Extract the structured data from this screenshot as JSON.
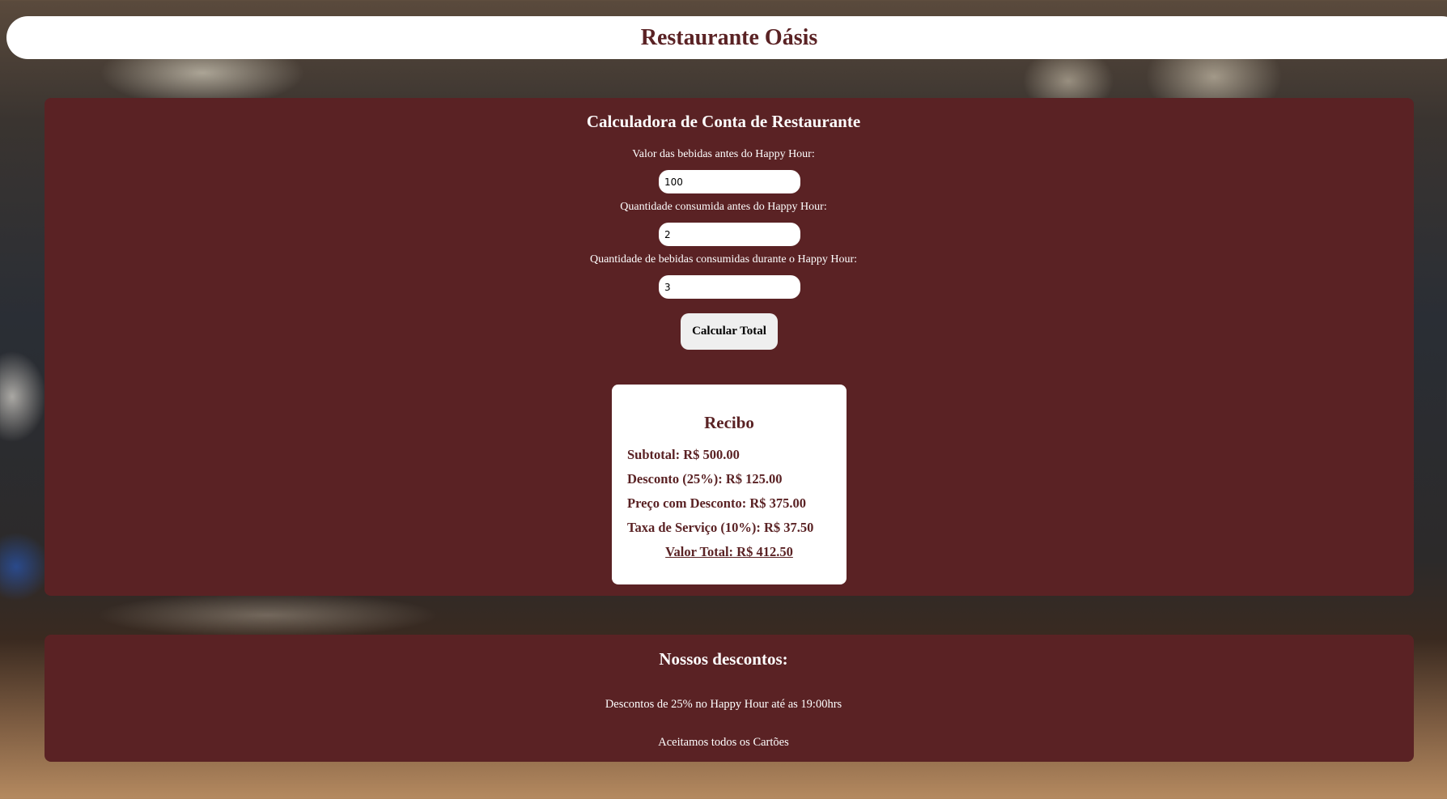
{
  "header": {
    "title": "Restaurante Oásis"
  },
  "calculator": {
    "title": "Calculadora de Conta de Restaurante",
    "fields": [
      {
        "label": "Valor das bebidas antes do Happy Hour:",
        "value": "100"
      },
      {
        "label": "Quantidade consumida antes do Happy Hour:",
        "value": "2"
      },
      {
        "label": "Quantidade de bebidas consumidas durante o Happy Hour:",
        "value": "3"
      }
    ],
    "button_label": "Calcular Total"
  },
  "receipt": {
    "title": "Recibo",
    "lines": [
      "Subtotal: R$ 500.00",
      "Desconto (25%): R$ 125.00",
      "Preço com Desconto: R$ 375.00",
      "Taxa de Serviço (10%): R$ 37.50"
    ],
    "total": "Valor Total: R$ 412.50"
  },
  "discounts": {
    "title": "Nossos descontos:",
    "items": [
      "Descontos de 25% no Happy Hour até as 19:00hrs",
      "Aceitamos todos os Cartões"
    ]
  },
  "colors": {
    "primary": "#5a2224",
    "panel_text": "#ffffff",
    "button_bg": "#efefef"
  }
}
